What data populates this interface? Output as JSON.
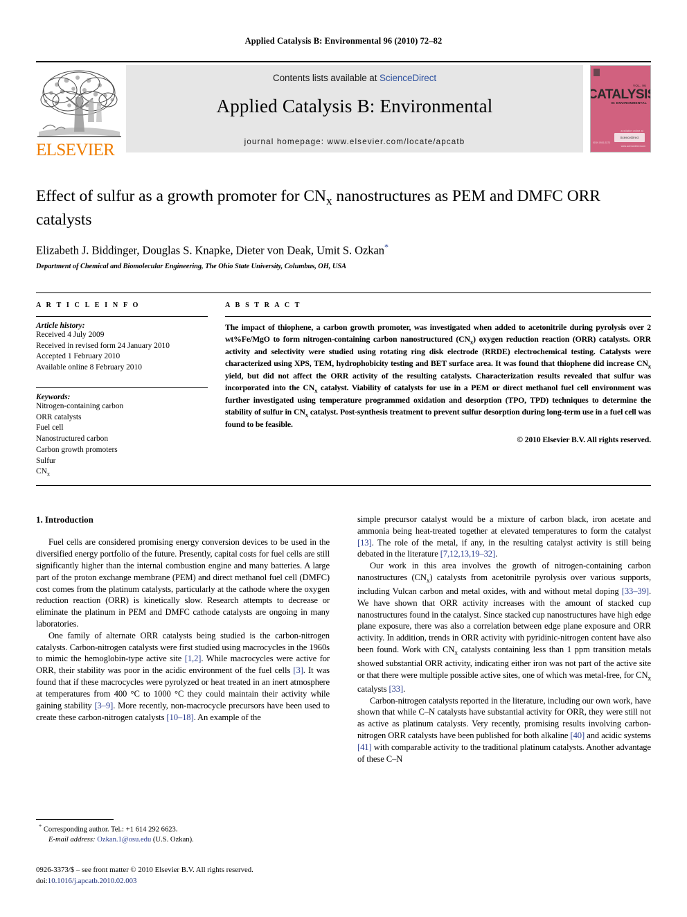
{
  "running_head": "Applied Catalysis B: Environmental 96 (2010) 72–82",
  "masthead": {
    "publisher_logo_label": "ELSEVIER",
    "contents_prefix": "Contents lists available at ",
    "contents_link": "ScienceDirect",
    "journal_title": "Applied Catalysis B: Environmental",
    "journal_homepage": "journal homepage: www.elsevier.com/locate/apcatb",
    "cover": {
      "main_word": "CATALYSIS",
      "sub_word": "B: ENVIRONMENTAL",
      "volume_line": "VOL. 96",
      "badge_text": "ScienceDirect",
      "badge_caption": "available online at",
      "badge_footer": "www.sciencedirect.com",
      "left_note": "ISSN 0926-3373",
      "background_color": "#d1617f"
    },
    "accent_colors": {
      "link_blue": "#2b4f9e",
      "elsevier_orange": "#ef7d00",
      "banner_grey": "#e6e6e6"
    }
  },
  "article": {
    "title": "Effect of sulfur as a growth promoter for CNx nanostructures as PEM and DMFC ORR catalysts",
    "title_part1": "Effect of sulfur as a growth promoter for CN",
    "title_sub": "x",
    "title_part2": " nanostructures as PEM and DMFC ORR catalysts",
    "authors": "Elizabeth J. Biddinger, Douglas S. Knapke, Dieter von Deak, Umit S. Ozkan",
    "corresponding_marker": "*",
    "affiliation": "Department of Chemical and Biomolecular Engineering, The Ohio State University, Columbus, OH, USA"
  },
  "info_panel": {
    "heading": "A R T I C L E    I N F O",
    "history_title": "Article history:",
    "history": [
      "Received 4 July 2009",
      "Received in revised form 24 January 2010",
      "Accepted 1 February 2010",
      "Available online 8 February 2010"
    ],
    "keywords_title": "Keywords:",
    "keywords": [
      "Nitrogen-containing carbon",
      "ORR catalysts",
      "Fuel cell",
      "Nanostructured carbon",
      "Carbon growth promoters",
      "Sulfur",
      "CNx"
    ]
  },
  "abstract": {
    "heading": "A B S T R A C T",
    "paragraph_part1": "The impact of thiophene, a carbon growth promoter, was investigated when added to acetonitrile during pyrolysis over 2 wt%Fe/MgO to form nitrogen-containing carbon nanostructured (CN",
    "paragraph_part2": ") oxygen reduction reaction (ORR) catalysts. ORR activity and selectivity were studied using rotating ring disk electrode (RRDE) electrochemical testing. Catalysts were characterized using XPS, TEM, hydrophobicity testing and BET surface area. It was found that thiophene did increase CN",
    "paragraph_part3": " yield, but did not affect the ORR activity of the resulting catalysts. Characterization results revealed that sulfur was incorporated into the CN",
    "paragraph_part4": " catalyst. Viability of catalysts for use in a PEM or direct methanol fuel cell environment was further investigated using temperature programmed oxidation and desorption (TPO, TPD) techniques to determine the stability of sulfur in CN",
    "paragraph_part5": " catalyst. Post-synthesis treatment to prevent sulfur desorption during long-term use in a fuel cell was found to be feasible.",
    "copyright": "© 2010 Elsevier B.V. All rights reserved."
  },
  "body": {
    "section_heading": "1. Introduction",
    "left_column": {
      "p1_a": "Fuel cells are considered promising energy conversion devices to be used in the diversified energy portfolio of the future. Presently, capital costs for fuel cells are still significantly higher than the internal combustion engine and many batteries. A large part of the proton exchange membrane (PEM) and direct methanol fuel cell (DMFC) cost comes from the platinum catalysts, particularly at the cathode where the oxygen reduction reaction (ORR) is kinetically slow. Research attempts to decrease or eliminate the platinum in PEM and DMFC cathode catalysts are ongoing in many laboratories.",
      "p2_a": "One family of alternate ORR catalysts being studied is the carbon-nitrogen catalysts. Carbon-nitrogen catalysts were first studied using macrocycles in the 1960s to mimic the hemoglobin-type active site ",
      "p2_cite1": "[1,2]",
      "p2_b": ". While macrocycles were active for ORR, their stability was poor in the acidic environment of the fuel cells ",
      "p2_cite2": "[3]",
      "p2_c": ". It was found that if these macrocycles were pyrolyzed or heat treated in an inert atmosphere at temperatures from 400 °C to 1000 °C they could maintain their activity while gaining stability ",
      "p2_cite3": "[3–9]",
      "p2_d": ". More recently, non-macrocycle precursors have been used to create these carbon-nitrogen catalysts ",
      "p2_cite4": "[10–18]",
      "p2_e": ". An example of the"
    },
    "right_column": {
      "p3_a": "simple precursor catalyst would be a mixture of carbon black, iron acetate and ammonia being heat-treated together at elevated temperatures to form the catalyst ",
      "p3_cite1": "[13]",
      "p3_b": ". The role of the metal, if any, in the resulting catalyst activity is still being debated in the literature ",
      "p3_cite2": "[7,12,13,19–32]",
      "p3_c": ".",
      "p4_a": "Our work in this area involves the growth of nitrogen-containing carbon nanostructures (CN",
      "p4_sub": "x",
      "p4_b": ") catalysts from acetonitrile pyrolysis over various supports, including Vulcan carbon and metal oxides, with and without metal doping ",
      "p4_cite1": "[33–39]",
      "p4_c": ". We have shown that ORR activity increases with the amount of stacked cup nanostructures found in the catalyst. Since stacked cup nanostructures have high edge plane exposure, there was also a correlation between edge plane exposure and ORR activity. In addition, trends in ORR activity with pyridinic-nitrogen content have also been found. Work with CN",
      "p4_d": " catalysts containing less than 1 ppm transition metals showed substantial ORR activity, indicating either iron was not part of the active site or that there were multiple possible active sites, one of which was metal-free, for CN",
      "p4_e": " catalysts ",
      "p4_cite2": "[33]",
      "p4_f": ".",
      "p5_a": "Carbon-nitrogen catalysts reported in the literature, including our own work, have shown that while C–N catalysts have substantial activity for ORR, they were still not as active as platinum catalysts. Very recently, promising results involving carbon-nitrogen ORR catalysts have been published for both alkaline ",
      "p5_cite1": "[40]",
      "p5_b": " and acidic systems ",
      "p5_cite2": "[41]",
      "p5_c": " with comparable activity to the traditional platinum catalysts. Another advantage of these C–N"
    }
  },
  "footnote": {
    "corresponding_marker": "*",
    "corresponding_text": " Corresponding author. Tel.: +1 614 292 6623.",
    "email_label": "E-mail address:",
    "email_value": "Ozkan.1@osu.edu",
    "email_owner": "(U.S. Ozkan)."
  },
  "footer": {
    "issn_line": "0926-3373/$ – see front matter © 2010 Elsevier B.V. All rights reserved.",
    "doi_label": "doi:",
    "doi_value": "10.1016/j.apcatb.2010.02.003"
  }
}
